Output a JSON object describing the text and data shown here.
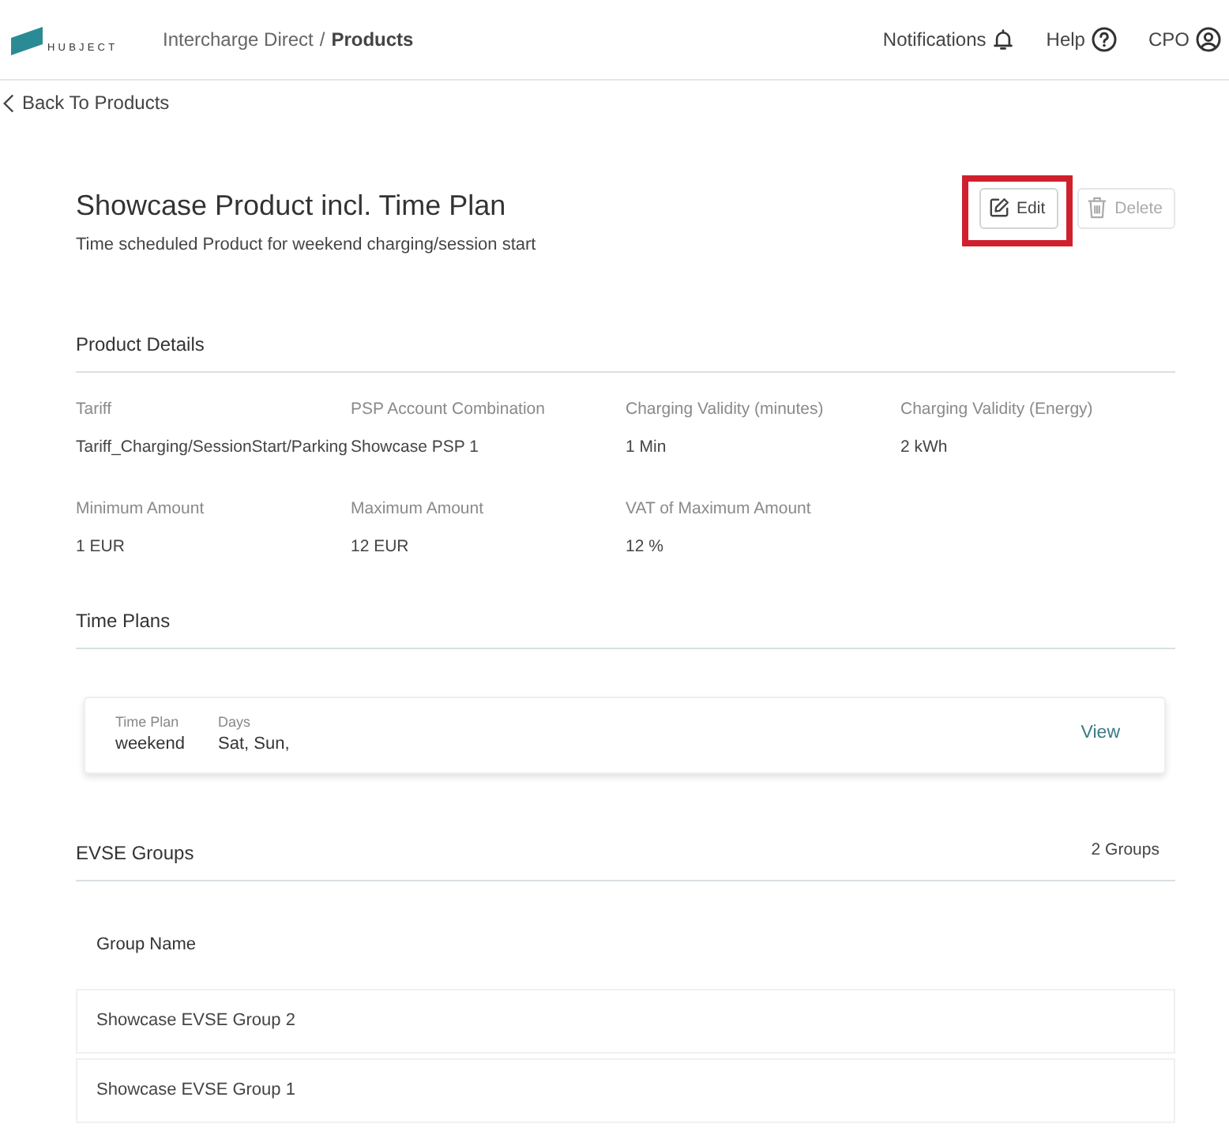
{
  "header": {
    "logo_text": "HUBJECT",
    "breadcrumb": [
      {
        "label": "Intercharge Direct",
        "current": false
      },
      {
        "label": "Products",
        "current": true
      }
    ],
    "separator": "/",
    "nav": [
      {
        "label": "Notifications",
        "kind": "bell"
      },
      {
        "label": "Help",
        "kind": "help"
      },
      {
        "label": "CPO",
        "kind": "user"
      }
    ]
  },
  "back_link": "Back To Products",
  "product": {
    "title": "Showcase Product incl. Time Plan",
    "subtitle": "Time scheduled Product for weekend charging/session start",
    "actions": [
      {
        "label": "Edit",
        "kind": "edit",
        "disabled": false,
        "highlighted": true
      },
      {
        "label": "Delete",
        "kind": "delete",
        "disabled": true,
        "highlighted": false
      }
    ]
  },
  "product_details": {
    "title": "Product Details",
    "fields": [
      {
        "label": "Tariff",
        "value": "Tariff_Charging/SessionStart/Parking"
      },
      {
        "label": "PSP Account Combination",
        "value": "Showcase PSP 1"
      },
      {
        "label": "Charging Validity (minutes)",
        "value": "1 Min"
      },
      {
        "label": "Charging Validity (Energy)",
        "value": "2 kWh"
      },
      {
        "label": "Minimum Amount",
        "value": "1 EUR"
      },
      {
        "label": "Maximum Amount",
        "value": "12 EUR"
      },
      {
        "label": "VAT of Maximum Amount",
        "value": "12 %"
      }
    ]
  },
  "time_plans": {
    "title": "Time Plans",
    "items": [
      {
        "fields": [
          {
            "label": "Time Plan",
            "value": "weekend"
          },
          {
            "label": "Days",
            "value": "Sat, Sun,"
          }
        ],
        "action": "View"
      }
    ]
  },
  "evse_groups": {
    "title": "EVSE Groups",
    "count": "2 Groups",
    "columns": [
      "Group Name"
    ],
    "rows": [
      [
        "Showcase EVSE Group 2"
      ],
      [
        "Showcase EVSE Group 1"
      ]
    ]
  }
}
